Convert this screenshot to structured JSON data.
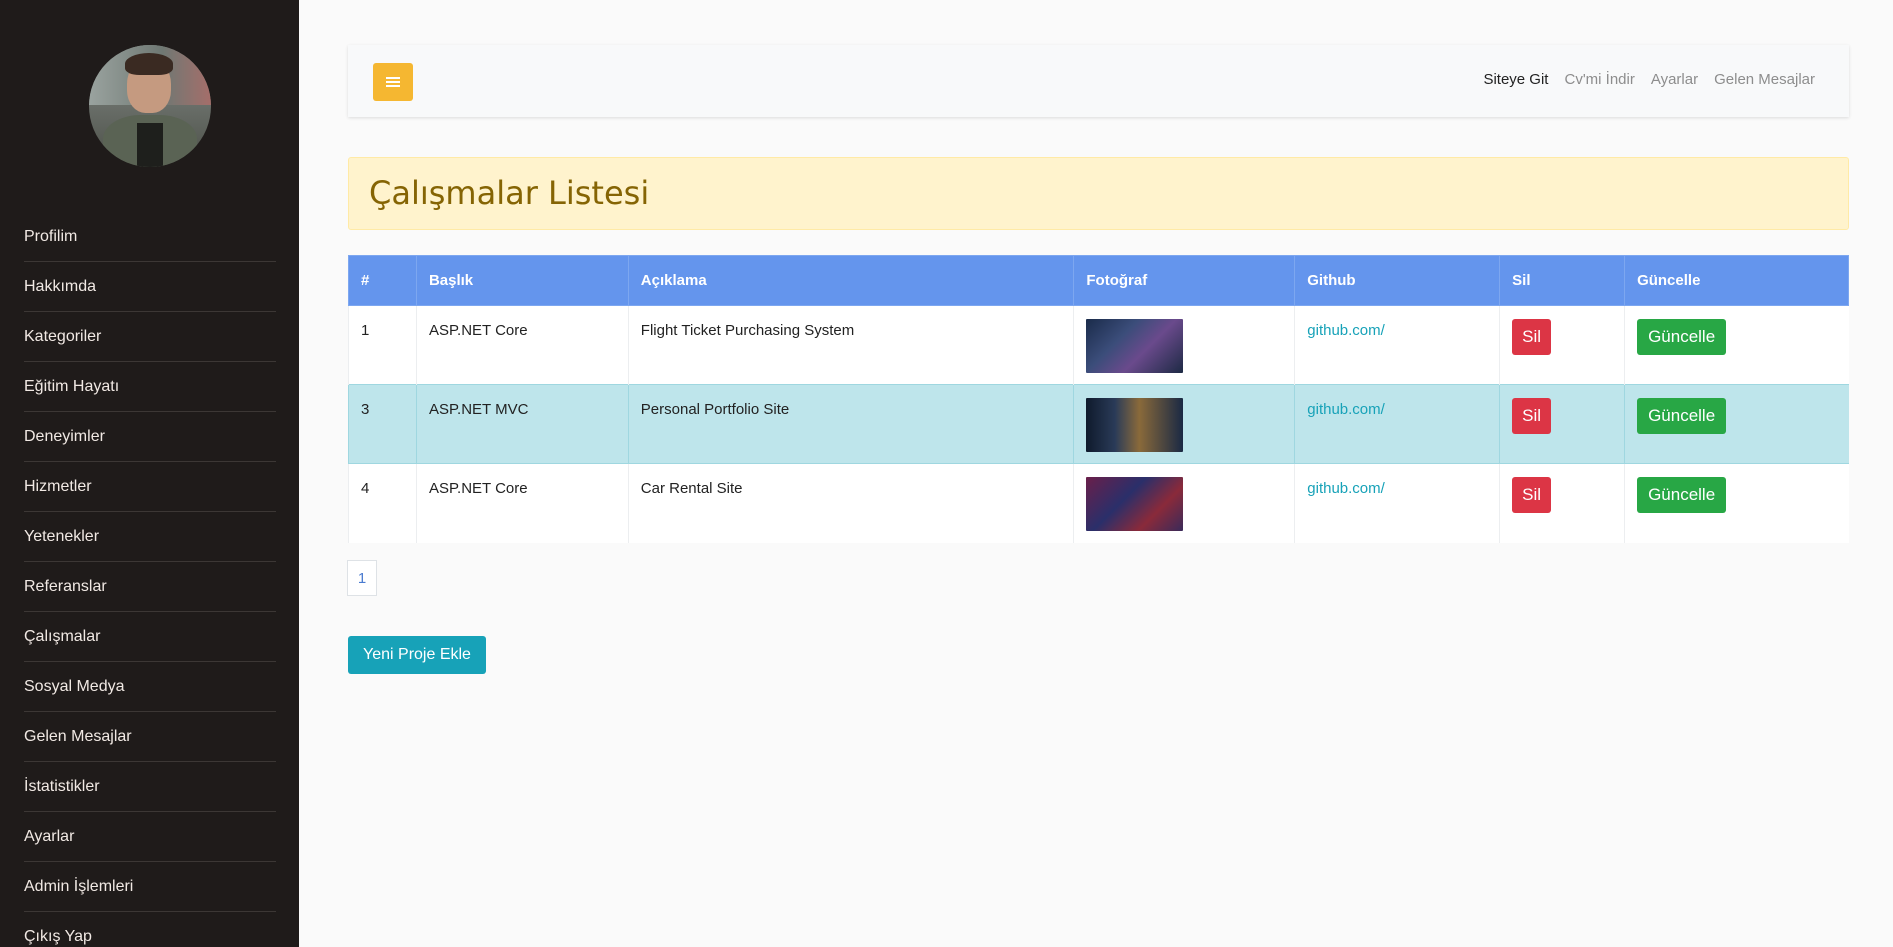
{
  "sidebar": {
    "items": [
      {
        "label": "Profilim"
      },
      {
        "label": "Hakkımda"
      },
      {
        "label": "Kategoriler"
      },
      {
        "label": "Eğitim Hayatı"
      },
      {
        "label": "Deneyimler"
      },
      {
        "label": "Hizmetler"
      },
      {
        "label": "Yetenekler"
      },
      {
        "label": "Referanslar"
      },
      {
        "label": "Çalışmalar"
      },
      {
        "label": "Sosyal Medya"
      },
      {
        "label": "Gelen Mesajlar"
      },
      {
        "label": "İstatistikler"
      },
      {
        "label": "Ayarlar"
      },
      {
        "label": "Admin İşlemleri"
      },
      {
        "label": "Çıkış Yap"
      }
    ]
  },
  "topbar": {
    "toggle_icon": "hamburger-icon",
    "toggle_color": "#f5b731",
    "nav": [
      {
        "label": "Siteye Git",
        "active": true
      },
      {
        "label": "Cv'mi İndir",
        "active": false
      },
      {
        "label": "Ayarlar",
        "active": false
      },
      {
        "label": "Gelen Mesajlar",
        "active": false
      }
    ]
  },
  "page": {
    "title": "Çalışmalar Listesi"
  },
  "table": {
    "headers": [
      "#",
      "Başlık",
      "Açıklama",
      "Fotoğraf",
      "Github",
      "Sil",
      "Güncelle"
    ],
    "rows": [
      {
        "id": "1",
        "title": "ASP.NET Core",
        "description": "Flight Ticket Purchasing System",
        "github": "github.com/",
        "delete_label": "Sil",
        "update_label": "Güncelle"
      },
      {
        "id": "3",
        "title": "ASP.NET MVC",
        "description": "Personal Portfolio Site",
        "github": "github.com/",
        "delete_label": "Sil",
        "update_label": "Güncelle"
      },
      {
        "id": "4",
        "title": "ASP.NET Core",
        "description": "Car Rental Site",
        "github": "github.com/",
        "delete_label": "Sil",
        "update_label": "Güncelle"
      }
    ]
  },
  "pagination": {
    "current": "1"
  },
  "actions": {
    "add_label": "Yeni Proje Ekle"
  },
  "colors": {
    "sidebar_bg": "#1f1b1a",
    "header_bg": "#6495ed",
    "highlight_row": "#bee5eb",
    "delete": "#dc3545",
    "update": "#28a745",
    "add": "#17a2b8"
  }
}
